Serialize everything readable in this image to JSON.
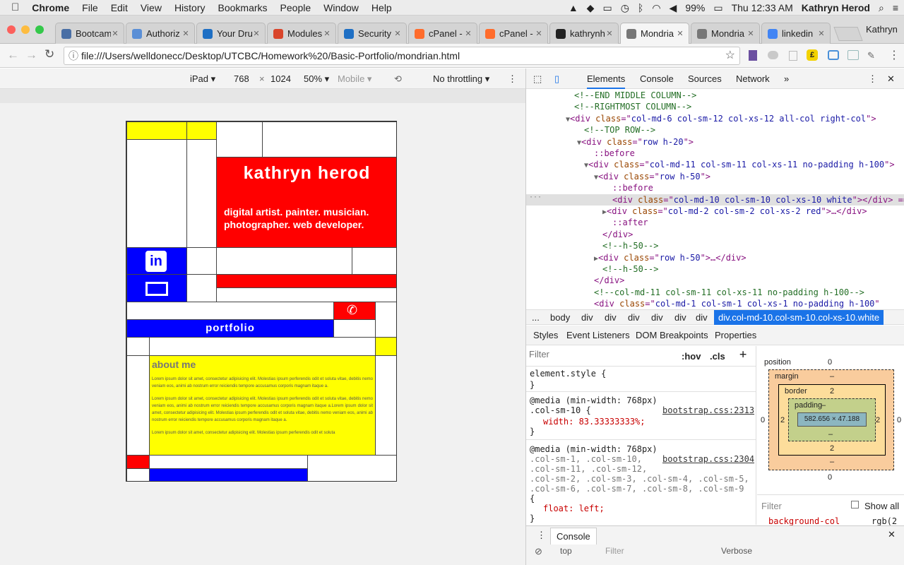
{
  "menubar": {
    "app": "Chrome",
    "items": [
      "File",
      "Edit",
      "View",
      "History",
      "Bookmarks",
      "People",
      "Window",
      "Help"
    ],
    "battery": "99%",
    "clock": "Thu 12:33 AM",
    "user": "Kathryn Herod"
  },
  "tabs": [
    {
      "title": "Bootcam",
      "icon_color": "#4a6fa5",
      "icon": "doc-icon"
    },
    {
      "title": "Authoriz",
      "icon_color": "#5a8fd6",
      "icon": "a-icon"
    },
    {
      "title": "Your Dru",
      "icon_color": "#1e6fc4",
      "icon": "drupal-icon"
    },
    {
      "title": "Modules",
      "icon_color": "#d9452b",
      "icon": "w-icon"
    },
    {
      "title": "Security",
      "icon_color": "#1e6fc4",
      "icon": "drupal-icon"
    },
    {
      "title": "cPanel -",
      "icon_color": "#ff6c2c",
      "icon": "cpanel-icon"
    },
    {
      "title": "cPanel -",
      "icon_color": "#ff6c2c",
      "icon": "cpanel-icon"
    },
    {
      "title": "kathrynh",
      "icon_color": "#222222",
      "icon": "github-icon"
    },
    {
      "title": "Mondria",
      "icon_color": "#777777",
      "icon": "doc-icon"
    },
    {
      "title": "Mondria",
      "icon_color": "#777777",
      "icon": "doc-icon"
    },
    {
      "title": "linkedin",
      "icon_color": "#4285f4",
      "icon": "google-icon"
    }
  ],
  "profile_name": "Kathryn",
  "url": "file:///Users/welldonecc/Desktop/UTCBC/Homework%20/Basic-Portfolio/mondrian.html",
  "device": {
    "name": "iPad",
    "width": "768",
    "x": "×",
    "height": "1024",
    "zoom": "50%",
    "mode": "Mobile",
    "throttle": "No throttling"
  },
  "site": {
    "name": "kathryn herod",
    "tagline": "digital artist. painter. musician. photographer. web developer.",
    "portfolio": "portfolio",
    "about_title": "about me",
    "about_p1": "Lorem ipsum dolor sit amet, consectetur adipisicing elit. Molestias ipsum perferendis odit et soluta vitae, debitis nemo veniam eos, animi ab nostrum error reiciendis tempore accusamus corporis magnam itaque a.",
    "about_p2": "Lorem ipsum dolor sit amet, consectetur adipisicing elit. Molestias ipsum perferendis odit et soluta vitae, debitis nemo veniam eos, animi ab nostrum error reiciendis tempore accusamus corporis magnam itaque a.Lorem ipsum dolor sit amet, consectetur adipisicing elit. Molestias ipsum perferendis odit et soluta vitae, debitis nemo veniam eos, animi ab nostrum error reiciendis tempore accusamus corporis magnam itaque a.",
    "about_p3": "Lorem ipsum dolor sit amet, consectetur adipisicing elit. Molestias ipsum perferendis odit et soluta"
  },
  "devtools": {
    "tabs": [
      "Elements",
      "Console",
      "Sources",
      "Network",
      "»"
    ],
    "dom": [
      {
        "t": "cm",
        "text": "<!--END MIDDLE COLUMN-->"
      },
      {
        "t": "cm",
        "text": "<!--RIGHTMOST COLUMN-->"
      },
      {
        "t": "el",
        "arrow": "▼",
        "tag": "div",
        "cls": "col-md-6 col-sm-12 col-xs-12 all-col right-col",
        "tail": ">"
      },
      {
        "t": "cm",
        "text": "<!--TOP ROW-->"
      },
      {
        "t": "el",
        "arrow": "▼",
        "tag": "div",
        "cls": "row h-20",
        "tail": ">"
      },
      {
        "t": "ps",
        "text": "::before"
      },
      {
        "t": "el",
        "arrow": "▼",
        "tag": "div",
        "cls": "col-md-11 col-sm-11 col-xs-11 no-padding h-100",
        "tail": ">"
      },
      {
        "t": "el",
        "arrow": "▼",
        "tag": "div",
        "cls": "row h-50",
        "tail": ">"
      },
      {
        "t": "ps",
        "text": "::before"
      },
      {
        "t": "el",
        "arrow": "",
        "tag": "div",
        "cls": "col-md-10 col-sm-10 col-xs-10 white",
        "tail": "></div> == $0"
      },
      {
        "t": "el",
        "arrow": "▶",
        "tag": "div",
        "cls": "col-md-2 col-sm-2 col-xs-2 red",
        "tail": ">…</div>"
      },
      {
        "t": "ps",
        "text": "::after"
      },
      {
        "t": "end",
        "text": "</div>"
      },
      {
        "t": "cm",
        "text": "<!--h-50-->"
      },
      {
        "t": "el",
        "arrow": "▶",
        "tag": "div",
        "cls": "row h-50",
        "tail": ">…</div>"
      },
      {
        "t": "cm",
        "text": "<!--h-50-->"
      },
      {
        "t": "end",
        "text": "</div>"
      },
      {
        "t": "cm",
        "text": "<!--col-md-11 col-sm-11 col-xs-11 no-padding h-100-->"
      },
      {
        "t": "el",
        "arrow": "",
        "tag": "div",
        "cls": "col-md-1 col-sm-1 col-xs-1  no-padding h-100",
        "tail": ""
      }
    ],
    "breadcrumbs": [
      "...",
      "body",
      "div",
      "div",
      "div",
      "div",
      "div",
      "div",
      "div.col-md-10.col-sm-10.col-xs-10.white"
    ],
    "style_tabs": [
      "Styles",
      "Event Listeners",
      "DOM Breakpoints",
      "Properties"
    ],
    "filter_placeholder": "Filter",
    "hov": ":hov",
    ".cls": ".cls",
    "styles": [
      "element.style {",
      "}",
      "@media (min-width: 768px)",
      ".col-sm-10 {",
      "width: 83.33333333%;",
      "}",
      "@media (min-width: 768px)",
      ".col-sm-1, .col-sm-10,",
      ".col-sm-11, .col-sm-12,",
      ".col-sm-2, .col-sm-3, .col-sm-4, .col-sm-5,",
      ".col-sm-6, .col-sm-7, .col-sm-8, .col-sm-9",
      "{",
      "float: left;",
      "}"
    ],
    "src1": "bootstrap.css:2313",
    "src2": "bootstrap.css:2304",
    "box": {
      "position": "position",
      "pos_val": "0",
      "margin": "margin",
      "margin_val": "–",
      "border": "border",
      "border_val": "2",
      "padding": "padding",
      "padding_val": "–",
      "content": "582.656 × 47.188",
      "side_zero": "0",
      "side_dash": "–",
      "side_two": "2"
    },
    "filter2": "Filter",
    "show_all": "Show all",
    "bg_prop": "background-col",
    "bg_val": "rgb(2",
    "console_label": "Console",
    "top_ctx": "top",
    "console_filter": "Filter",
    "verbose": "Verbose"
  }
}
